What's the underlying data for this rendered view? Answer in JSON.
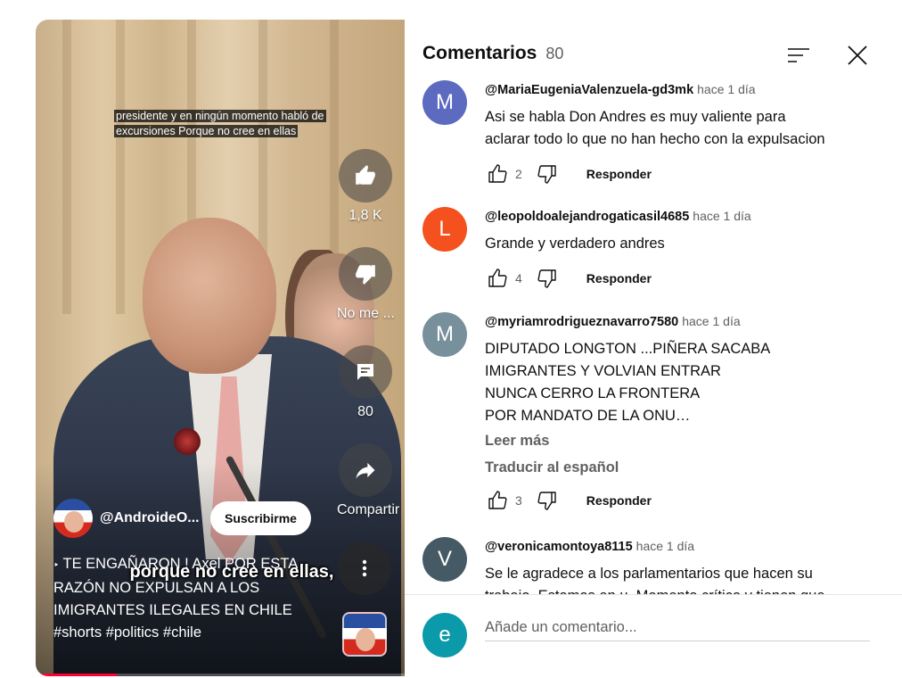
{
  "video": {
    "caption_top_line1": "presidente y en ningún momento habló de",
    "caption_top_line2": "excursiones Porque no cree en ellas",
    "burned_subtitle": "porque no cree en ellas,",
    "like_count": "1,8 K",
    "dislike_label": "No me ...",
    "comments_count": "80",
    "share_label": "Compartir",
    "channel_name": "@AndroideO...",
    "subscribe_label": "Suscribirme",
    "title_prefix": "‣",
    "title": "TE ENGAÑARON ! Axel POR ESTA RAZÓN NO EXPULSAN A LOS IMIGRANTES ILEGALES EN CHILE #shorts #politics #chile",
    "progress_fraction": 0.22
  },
  "panel": {
    "title": "Comentarios",
    "count": "80",
    "sort_icon": "sort-icon",
    "close_icon": "close-icon"
  },
  "comments": [
    {
      "initial": "M",
      "avatar_color": "#5c6bc0",
      "author": "@MariaEugeniaValenzuela-gd3mk",
      "time": "hace 1 día",
      "text_lines": [
        "Asi se habla Don Andres es muy valiente para",
        "aclarar todo lo que no han hecho con la expulsacion"
      ],
      "likes": "2",
      "reply": "Responder"
    },
    {
      "initial": "L",
      "avatar_color": "#f4511e",
      "author": "@leopoldoalejandrogaticasil4685",
      "time": "hace 1 día",
      "text_lines": [
        "Grande y verdadero andres"
      ],
      "likes": "4",
      "reply": "Responder"
    },
    {
      "initial": "M",
      "avatar_color": "#78909c",
      "author": "@myriamrodrigueznavarro7580",
      "time": "hace 1 día",
      "text_lines": [
        "DIPUTADO LONGTON ...PIÑERA SACABA",
        "IMIGRANTES Y VOLVIAN ENTRAR",
        "NUNCA CERRO LA FRONTERA",
        "POR MANDATO DE LA ONU…"
      ],
      "read_more": "Leer más",
      "translate": "Traducir al español",
      "likes": "3",
      "reply": "Responder"
    },
    {
      "initial": "V",
      "avatar_color": "#455a64",
      "author": "@veronicamontoya8115",
      "time": "hace 1 día",
      "text_lines": [
        "Se le agradece a los parlamentarios que hacen su",
        "trabajo. Estamos en u. Momento crítico y tienen que"
      ],
      "likes": "",
      "reply": "Responder"
    }
  ],
  "compose": {
    "initial": "e",
    "avatar_color": "#0b9aa9",
    "placeholder": "Añade un comentario..."
  }
}
